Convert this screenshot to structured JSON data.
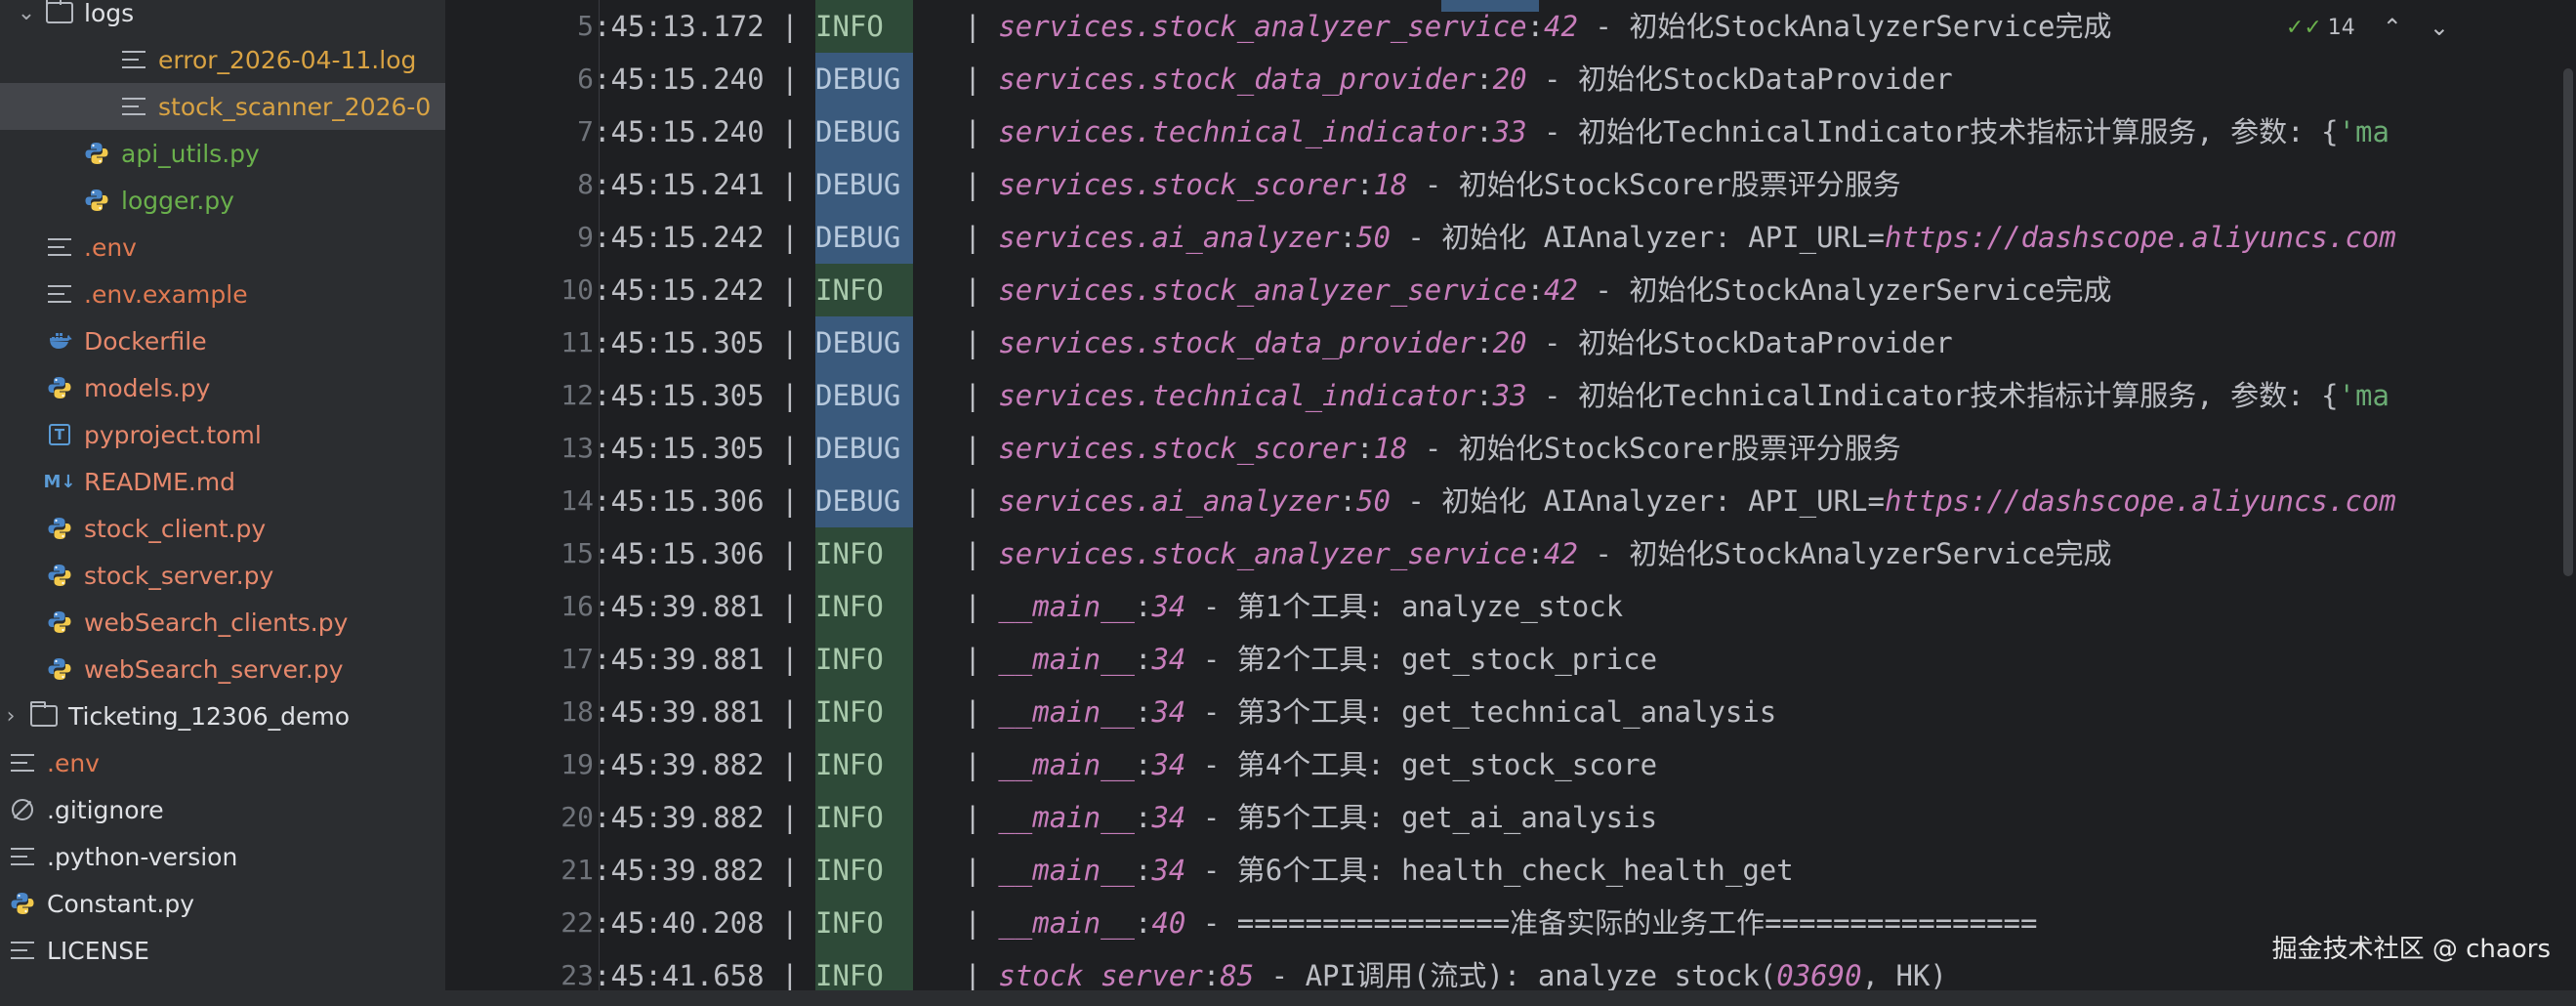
{
  "sidebar": {
    "items": [
      {
        "label": "logs",
        "icon": "folder-icon",
        "color": "#dfe1e5",
        "indent": 1,
        "chevron": "⌄"
      },
      {
        "label": "error_2026-04-11.log",
        "icon": "log-file-icon",
        "color": "#d9a343",
        "indent": 3
      },
      {
        "label": "stock_scanner_2026-0",
        "icon": "log-file-icon",
        "color": "#d9a343",
        "indent": 3,
        "selected": true
      },
      {
        "label": "api_utils.py",
        "icon": "python-file-icon",
        "color": "#6ab04c",
        "indent": 2
      },
      {
        "label": "logger.py",
        "icon": "python-file-icon",
        "color": "#6ab04c",
        "indent": 2
      },
      {
        "label": ".env",
        "icon": "text-file-icon",
        "color": "#e07a52",
        "indent": 1
      },
      {
        "label": ".env.example",
        "icon": "text-file-icon",
        "color": "#e07a52",
        "indent": 1
      },
      {
        "label": "Dockerfile",
        "icon": "docker-icon",
        "color": "#e6886c",
        "indent": 1
      },
      {
        "label": "models.py",
        "icon": "python-file-icon",
        "color": "#e6886c",
        "indent": 1
      },
      {
        "label": "pyproject.toml",
        "icon": "toml-file-icon",
        "color": "#e6886c",
        "indent": 1
      },
      {
        "label": "README.md",
        "icon": "markdown-file-icon",
        "color": "#e6886c",
        "indent": 1
      },
      {
        "label": "stock_client.py",
        "icon": "python-file-icon",
        "color": "#e6886c",
        "indent": 1
      },
      {
        "label": "stock_server.py",
        "icon": "python-file-icon",
        "color": "#e6886c",
        "indent": 1
      },
      {
        "label": "webSearch_clients.py",
        "icon": "python-file-icon",
        "color": "#e6886c",
        "indent": 1
      },
      {
        "label": "webSearch_server.py",
        "icon": "python-file-icon",
        "color": "#e6886c",
        "indent": 1
      },
      {
        "label": "Ticketing_12306_demo",
        "icon": "folder-icon",
        "color": "#dfe1e5",
        "indent": 0,
        "chevron": "›"
      },
      {
        "label": ".env",
        "icon": "text-file-icon",
        "color": "#e07a52",
        "indent": 0
      },
      {
        "label": ".gitignore",
        "icon": "gitignore-icon",
        "color": "#dfe1e5",
        "indent": 0
      },
      {
        "label": ".python-version",
        "icon": "text-file-icon",
        "color": "#dfe1e5",
        "indent": 0
      },
      {
        "label": "Constant.py",
        "icon": "python-file-icon",
        "color": "#dfe1e5",
        "indent": 0
      },
      {
        "label": "LICENSE",
        "icon": "text-file-icon",
        "color": "#dfe1e5",
        "indent": 0
      }
    ]
  },
  "editor": {
    "inspection_count": "14",
    "watermark": "掘金技术社区 @ chaors",
    "lines": [
      {
        "n": "5",
        "time": ":45:13.172",
        "level": "INFO",
        "kind": "info",
        "module": "services.stock_analyzer_service",
        "lineno": "42",
        "msg": " - 初始化StockAnalyzerService完成"
      },
      {
        "n": "6",
        "time": ":45:15.240",
        "level": "DEBUG",
        "kind": "debug",
        "module": "services.stock_data_provider",
        "lineno": "20",
        "msg": " - 初始化StockDataProvider"
      },
      {
        "n": "7",
        "time": ":45:15.240",
        "level": "DEBUG",
        "kind": "debug",
        "module": "services.technical_indicator",
        "lineno": "33",
        "msg": " - 初始化TechnicalIndicator技术指标计算服务, 参数: {",
        "str": "'ma"
      },
      {
        "n": "8",
        "time": ":45:15.241",
        "level": "DEBUG",
        "kind": "debug",
        "module": "services.stock_scorer",
        "lineno": "18",
        "msg": " - 初始化StockScorer股票评分服务"
      },
      {
        "n": "9",
        "time": ":45:15.242",
        "level": "DEBUG",
        "kind": "debug",
        "module": "services.ai_analyzer",
        "lineno": "50",
        "msg": " - 初始化 AIAnalyzer: API_URL=",
        "url": "https://dashscope.aliyuncs.com"
      },
      {
        "n": "10",
        "time": ":45:15.242",
        "level": "INFO",
        "kind": "info",
        "module": "services.stock_analyzer_service",
        "lineno": "42",
        "msg": " - 初始化StockAnalyzerService完成"
      },
      {
        "n": "11",
        "time": ":45:15.305",
        "level": "DEBUG",
        "kind": "debug",
        "module": "services.stock_data_provider",
        "lineno": "20",
        "msg": " - 初始化StockDataProvider"
      },
      {
        "n": "12",
        "time": ":45:15.305",
        "level": "DEBUG",
        "kind": "debug",
        "module": "services.technical_indicator",
        "lineno": "33",
        "msg": " - 初始化TechnicalIndicator技术指标计算服务, 参数: {",
        "str": "'ma"
      },
      {
        "n": "13",
        "time": ":45:15.305",
        "level": "DEBUG",
        "kind": "debug",
        "module": "services.stock_scorer",
        "lineno": "18",
        "msg": " - 初始化StockScorer股票评分服务"
      },
      {
        "n": "14",
        "time": ":45:15.306",
        "level": "DEBUG",
        "kind": "debug",
        "module": "services.ai_analyzer",
        "lineno": "50",
        "msg": " - 初始化 AIAnalyzer: API_URL=",
        "url": "https://dashscope.aliyuncs.com"
      },
      {
        "n": "15",
        "time": ":45:15.306",
        "level": "INFO",
        "kind": "info",
        "module": "services.stock_analyzer_service",
        "lineno": "42",
        "msg": " - 初始化StockAnalyzerService完成"
      },
      {
        "n": "16",
        "time": ":45:39.881",
        "level": "INFO",
        "kind": "info",
        "module": "__main__",
        "lineno": "34",
        "msg": " - 第1个工具: analyze_stock"
      },
      {
        "n": "17",
        "time": ":45:39.881",
        "level": "INFO",
        "kind": "info",
        "module": "__main__",
        "lineno": "34",
        "msg": " - 第2个工具: get_stock_price"
      },
      {
        "n": "18",
        "time": ":45:39.881",
        "level": "INFO",
        "kind": "info",
        "module": "__main__",
        "lineno": "34",
        "msg": " - 第3个工具: get_technical_analysis"
      },
      {
        "n": "19",
        "time": ":45:39.882",
        "level": "INFO",
        "kind": "info",
        "module": "__main__",
        "lineno": "34",
        "msg": " - 第4个工具: get_stock_score"
      },
      {
        "n": "20",
        "time": ":45:39.882",
        "level": "INFO",
        "kind": "info",
        "module": "__main__",
        "lineno": "34",
        "msg": " - 第5个工具: get_ai_analysis"
      },
      {
        "n": "21",
        "time": ":45:39.882",
        "level": "INFO",
        "kind": "info",
        "module": "__main__",
        "lineno": "34",
        "msg": " - 第6个工具: health_check_health_get"
      },
      {
        "n": "22",
        "time": ":45:40.208",
        "level": "INFO",
        "kind": "info",
        "module": "__main__",
        "lineno": "40",
        "msg": " - ================准备实际的业务工作================"
      },
      {
        "n": "23",
        "time": ":45:41.658",
        "level": "INFO",
        "kind": "info",
        "module": "stock_server",
        "lineno": "85",
        "msg": " - API调用(流式): analyze_stock(",
        "url": "03690",
        "tail": ", HK)"
      }
    ]
  }
}
